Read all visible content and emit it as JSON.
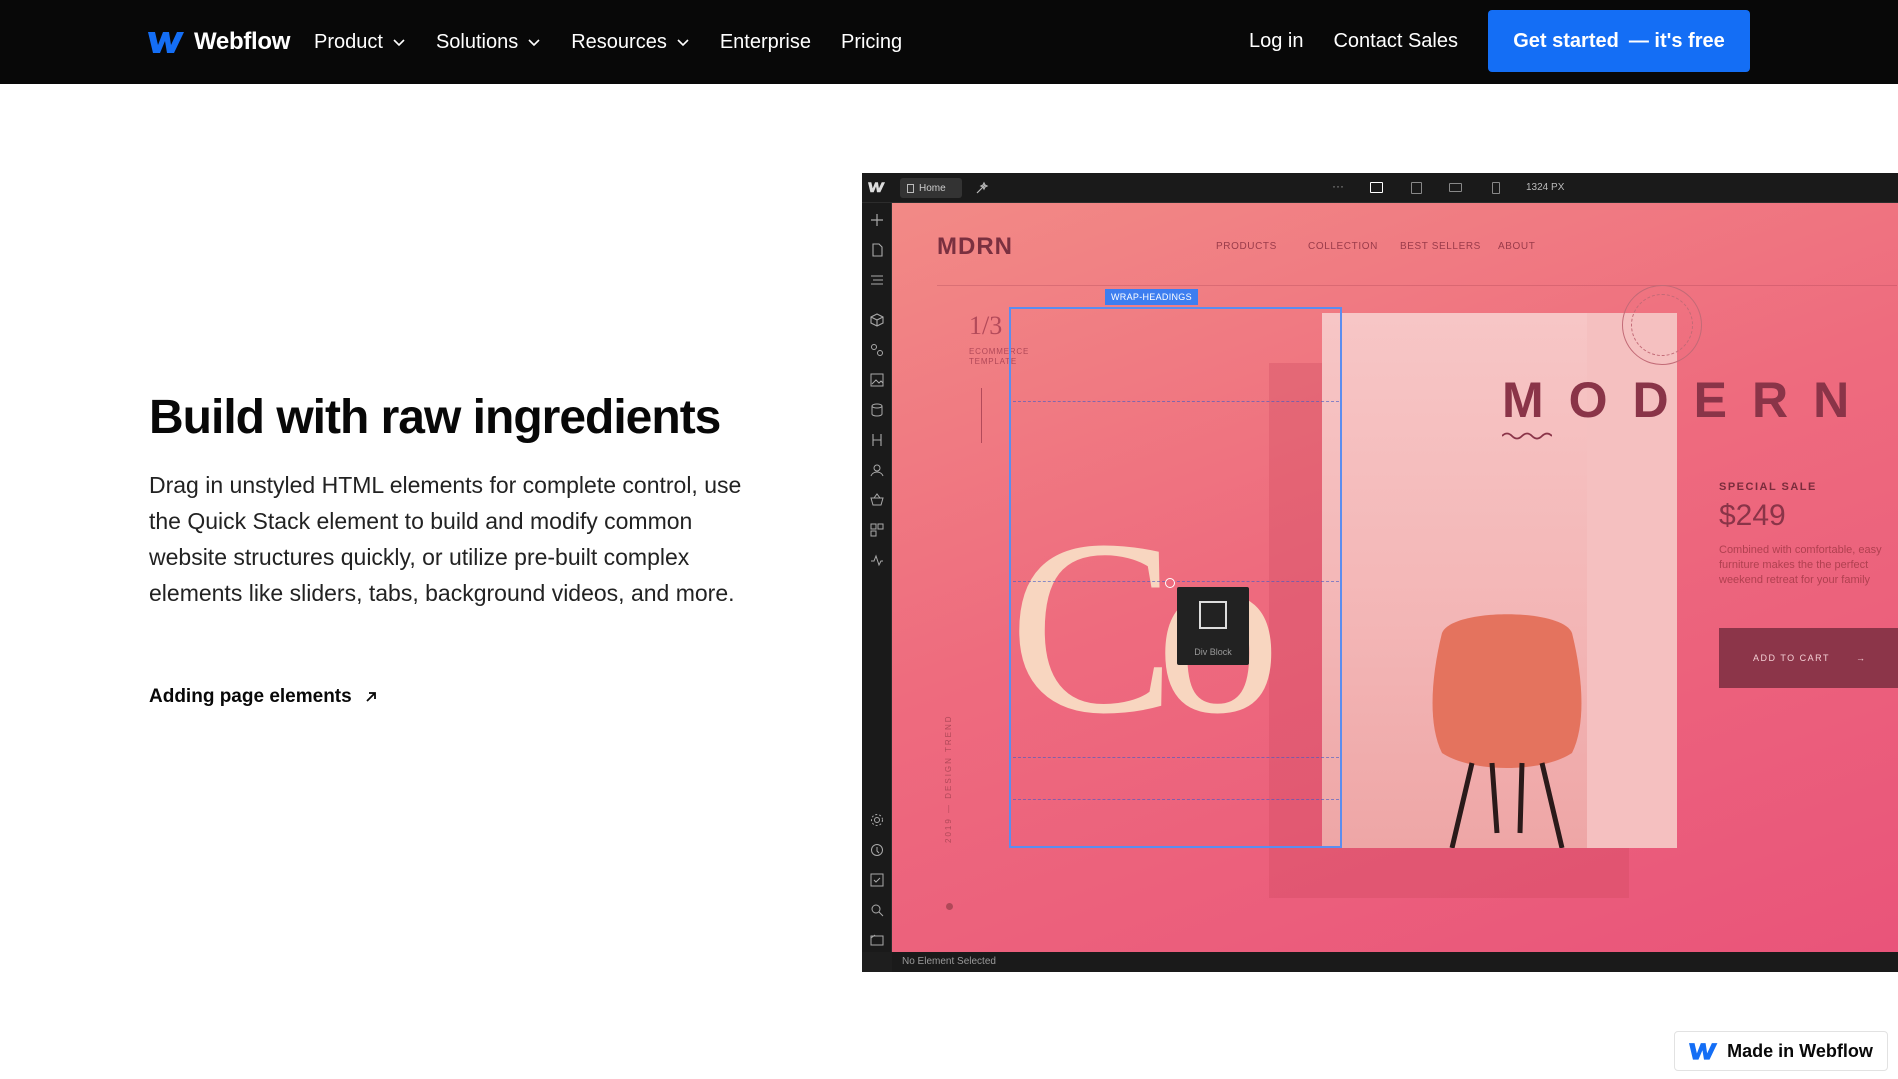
{
  "nav": {
    "brand": "Webflow",
    "links": [
      {
        "label": "Product",
        "dropdown": true
      },
      {
        "label": "Solutions",
        "dropdown": true
      },
      {
        "label": "Resources",
        "dropdown": true
      },
      {
        "label": "Enterprise",
        "dropdown": false
      },
      {
        "label": "Pricing",
        "dropdown": false
      }
    ],
    "login": "Log in",
    "contact": "Contact Sales",
    "cta_main": "Get started",
    "cta_sub": "— it's free",
    "accent": "#146ef5"
  },
  "feature": {
    "title": "Build with raw ingredients",
    "body": "Drag in unstyled HTML elements for complete control, use the Quick Stack element to build and modify common website structures quickly, or utilize pre-built complex elements like sliders, tabs, background videos, and more.",
    "link": "Adding page elements"
  },
  "designer": {
    "page_tab": "Home",
    "more": "···",
    "canvas_width": "1324 PX",
    "status": "No Element Selected",
    "icons": [
      "add-icon",
      "pages-icon",
      "navigator-icon",
      "components-icon",
      "variables-icon",
      "assets-icon",
      "cms-icon",
      "logic-icon",
      "users-icon",
      "ecommerce-icon",
      "apps-icon",
      "activity-icon",
      "settings-icon",
      "audit-icon",
      "checklist-icon",
      "search-icon",
      "video-icon"
    ],
    "canvas": {
      "logo": "MDRN",
      "menu": [
        "PRODUCTS",
        "COLLECTION",
        "BEST SELLERS",
        "ABOUT"
      ],
      "slide": "1/3",
      "slide_sub_1": "ECOMMERCE",
      "slide_sub_2": "TEMPLATE",
      "vertical_text": "2019 — DESIGN TREND",
      "selection_label": "WRAP-HEADINGS",
      "headline_letters": "Co",
      "drag_label": "Div Block",
      "brand_word": "MODERN",
      "sale_label": "SPECIAL SALE",
      "price": "$249",
      "description": "Combined with comfortable, easy furniture makes the the perfect weekend retreat for your family",
      "cart": "ADD TO CART",
      "cart_arrow": "→"
    }
  },
  "badge": {
    "label": "Made in Webflow"
  }
}
